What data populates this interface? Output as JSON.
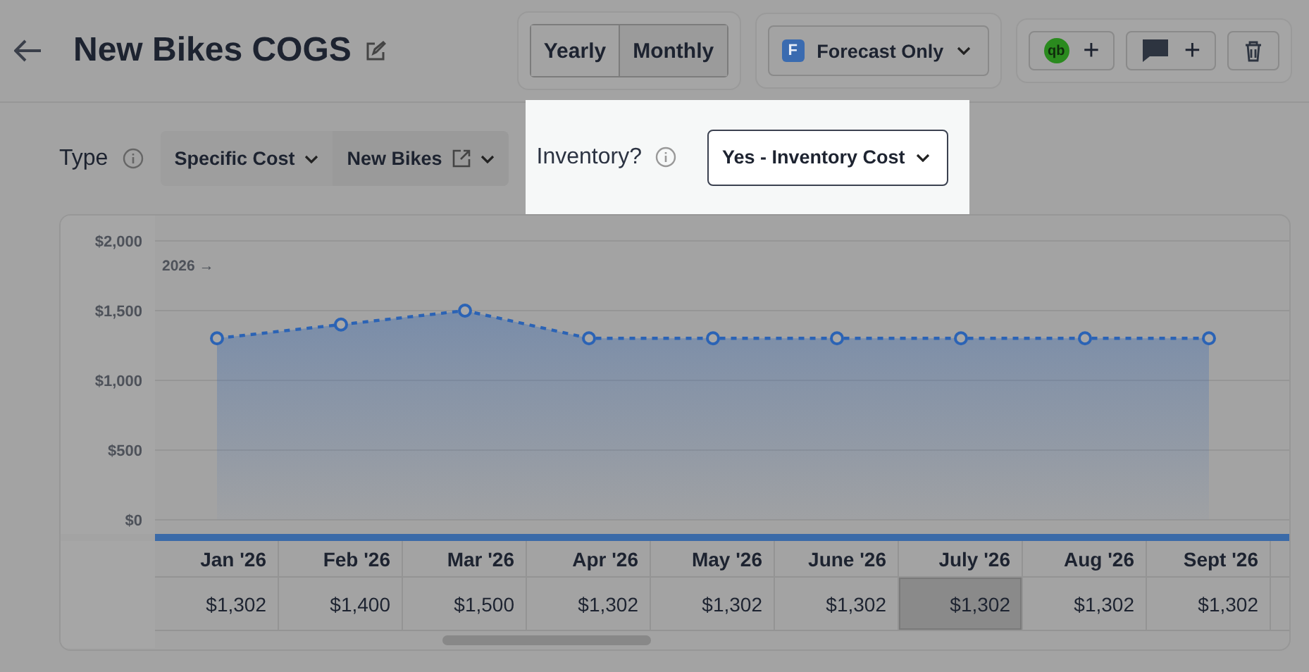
{
  "header": {
    "title": "New Bikes COGS",
    "period_toggle": [
      {
        "label": "Yearly",
        "selected": false
      },
      {
        "label": "Monthly",
        "selected": true
      }
    ],
    "scenario": {
      "badge": "F",
      "label": "Forecast Only"
    },
    "actions": [
      {
        "kind": "qb",
        "badge": "qb",
        "label": "+"
      },
      {
        "kind": "comment",
        "label": "+"
      },
      {
        "kind": "delete"
      }
    ]
  },
  "filters": {
    "type_label": "Type",
    "type_value": "Specific Cost",
    "item_value": "New Bikes",
    "inventory_label": "Inventory?",
    "inventory_value": "Yes - Inventory Cost"
  },
  "chart": {
    "year_label": "2026 →",
    "chart_data": {
      "type": "area",
      "categories": [
        "Jan '26",
        "Feb '26",
        "Mar '26",
        "Apr '26",
        "May '26",
        "June '26",
        "July '26",
        "Aug '26",
        "Sept '26"
      ],
      "grid": true,
      "series": [
        {
          "color": "#2b63b5",
          "values": [
            1302,
            1400,
            1500,
            1302,
            1302,
            1302,
            1302,
            1302,
            1302
          ]
        }
      ],
      "ylim": [
        0,
        2000
      ],
      "yticks": [
        {
          "value": 0,
          "label": "$0"
        },
        {
          "value": 500,
          "label": "$500"
        },
        {
          "value": 1000,
          "label": "$1,000"
        },
        {
          "value": 1500,
          "label": "$1,500"
        },
        {
          "value": 2000,
          "label": "$2,000"
        }
      ]
    }
  },
  "values_row": [
    {
      "text": "$1,302",
      "selected": false
    },
    {
      "text": "$1,400",
      "selected": false
    },
    {
      "text": "$1,500",
      "selected": false
    },
    {
      "text": "$1,302",
      "selected": false
    },
    {
      "text": "$1,302",
      "selected": false
    },
    {
      "text": "$1,302",
      "selected": false
    },
    {
      "text": "$1,302",
      "selected": true
    },
    {
      "text": "$1,302",
      "selected": false
    },
    {
      "text": "$1,302",
      "selected": false
    }
  ]
}
